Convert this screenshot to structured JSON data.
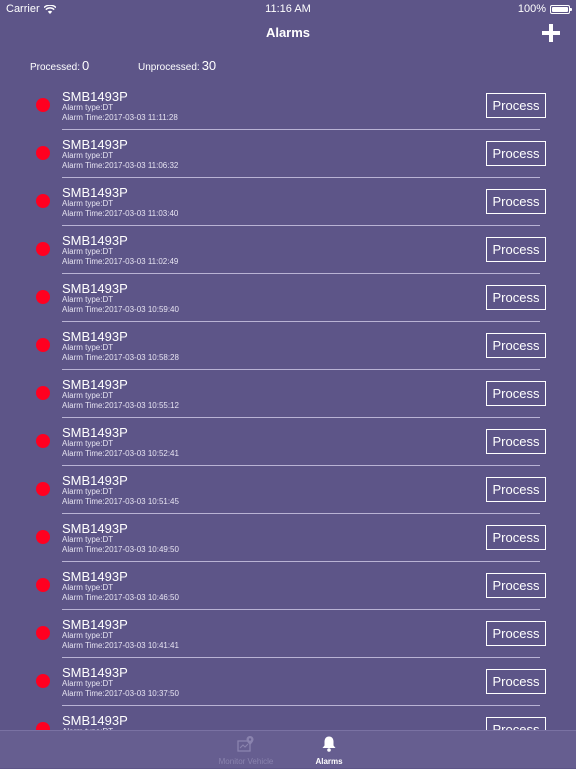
{
  "status_bar": {
    "carrier": "Carrier",
    "time": "11:16 AM",
    "battery": "100%"
  },
  "nav": {
    "title": "Alarms"
  },
  "summary": {
    "processed_label": "Processed:",
    "processed_count": "0",
    "unprocessed_label": "Unprocessed:",
    "unprocessed_count": "30"
  },
  "alarms": [
    {
      "plate": "SMB1493P",
      "type": "Alarm type:DT",
      "time": "Alarm Time:2017-03-03 11:11:28",
      "action": "Process"
    },
    {
      "plate": "SMB1493P",
      "type": "Alarm type:DT",
      "time": "Alarm Time:2017-03-03 11:06:32",
      "action": "Process"
    },
    {
      "plate": "SMB1493P",
      "type": "Alarm type:DT",
      "time": "Alarm Time:2017-03-03 11:03:40",
      "action": "Process"
    },
    {
      "plate": "SMB1493P",
      "type": "Alarm type:DT",
      "time": "Alarm Time:2017-03-03 11:02:49",
      "action": "Process"
    },
    {
      "plate": "SMB1493P",
      "type": "Alarm type:DT",
      "time": "Alarm Time:2017-03-03 10:59:40",
      "action": "Process"
    },
    {
      "plate": "SMB1493P",
      "type": "Alarm type:DT",
      "time": "Alarm Time:2017-03-03 10:58:28",
      "action": "Process"
    },
    {
      "plate": "SMB1493P",
      "type": "Alarm type:DT",
      "time": "Alarm Time:2017-03-03 10:55:12",
      "action": "Process"
    },
    {
      "plate": "SMB1493P",
      "type": "Alarm type:DT",
      "time": "Alarm Time:2017-03-03 10:52:41",
      "action": "Process"
    },
    {
      "plate": "SMB1493P",
      "type": "Alarm type:DT",
      "time": "Alarm Time:2017-03-03 10:51:45",
      "action": "Process"
    },
    {
      "plate": "SMB1493P",
      "type": "Alarm type:DT",
      "time": "Alarm Time:2017-03-03 10:49:50",
      "action": "Process"
    },
    {
      "plate": "SMB1493P",
      "type": "Alarm type:DT",
      "time": "Alarm Time:2017-03-03 10:46:50",
      "action": "Process"
    },
    {
      "plate": "SMB1493P",
      "type": "Alarm type:DT",
      "time": "Alarm Time:2017-03-03 10:41:41",
      "action": "Process"
    },
    {
      "plate": "SMB1493P",
      "type": "Alarm type:DT",
      "time": "Alarm Time:2017-03-03 10:37:50",
      "action": "Process"
    },
    {
      "plate": "SMB1493P",
      "type": "Alarm type:DT",
      "time": "",
      "action": "Process"
    }
  ],
  "tabs": [
    {
      "label": "Monitor Vehicle",
      "icon": "map-pin-icon",
      "selected": false
    },
    {
      "label": "Alarms",
      "icon": "bell-icon",
      "selected": true
    }
  ],
  "colors": {
    "background": "#5d5588",
    "alarm_dot": "#ff0020",
    "tab_bar": "#665e90"
  }
}
